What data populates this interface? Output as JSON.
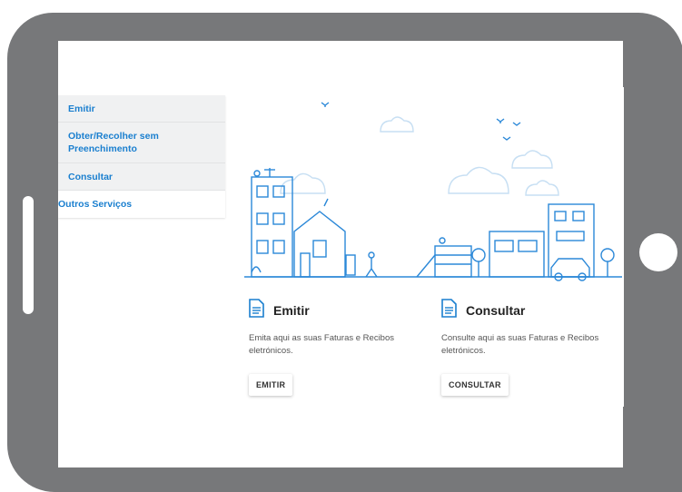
{
  "menu": {
    "items": [
      {
        "label": "Emitir"
      },
      {
        "label": "Obter/Recolher sem Preenchimento"
      },
      {
        "label": "Consultar"
      }
    ],
    "other_label": "Outros Serviços"
  },
  "cards": {
    "emitir": {
      "title": "Emitir",
      "description": "Emita aqui as suas Faturas e Recibos eletrónicos.",
      "button_label": "EMITIR",
      "icon": "document-icon"
    },
    "consultar": {
      "title": "Consultar",
      "description": "Consulte aqui as suas Faturas e Recibos eletrónicos.",
      "button_label": "CONSULTAR",
      "icon": "document-icon"
    }
  },
  "colors": {
    "accent": "#1a7fcf",
    "line": "#2b88d8",
    "device": "#77787a"
  }
}
